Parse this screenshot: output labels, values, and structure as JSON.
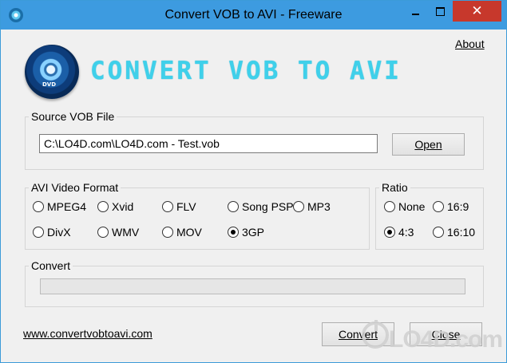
{
  "window": {
    "title": "Convert VOB to AVI - Freeware",
    "controls": {
      "minimize": "minimize",
      "maximize": "maximize",
      "close": "✕"
    }
  },
  "header": {
    "about_link": "About",
    "logo_text": "CONVERT VOB TO AVI",
    "logo_disc_label": "DVD"
  },
  "source": {
    "legend": "Source VOB File",
    "path_value": "C:\\LO4D.com\\LO4D.com - Test.vob",
    "open_button": "Open"
  },
  "format": {
    "legend": "AVI Video Format",
    "options": [
      {
        "label": "MPEG4",
        "checked": false
      },
      {
        "label": "Xvid",
        "checked": false
      },
      {
        "label": "FLV",
        "checked": false
      },
      {
        "label": "Song PSP",
        "checked": false
      },
      {
        "label": "MP3",
        "checked": false
      },
      {
        "label": "DivX",
        "checked": false
      },
      {
        "label": "WMV",
        "checked": false
      },
      {
        "label": "MOV",
        "checked": false
      },
      {
        "label": "3GP",
        "checked": true
      }
    ],
    "selected": "3GP"
  },
  "ratio": {
    "legend": "Ratio",
    "options": [
      {
        "label": "None",
        "checked": false
      },
      {
        "label": "16:9",
        "checked": false
      },
      {
        "label": "4:3",
        "checked": true
      },
      {
        "label": "16:10",
        "checked": false
      }
    ],
    "selected": "4:3"
  },
  "convert": {
    "legend": "Convert",
    "progress": 0
  },
  "footer": {
    "site_link": "www.convertvobtoavi.com",
    "convert_button": "Convert",
    "close_button": "Close"
  },
  "watermark": {
    "text": "LO4D.com"
  },
  "colors": {
    "titlebar": "#3d9be0",
    "close_button": "#c7382c",
    "logo_text": "#3fd0ea",
    "window_bg": "#f0f0f0"
  }
}
